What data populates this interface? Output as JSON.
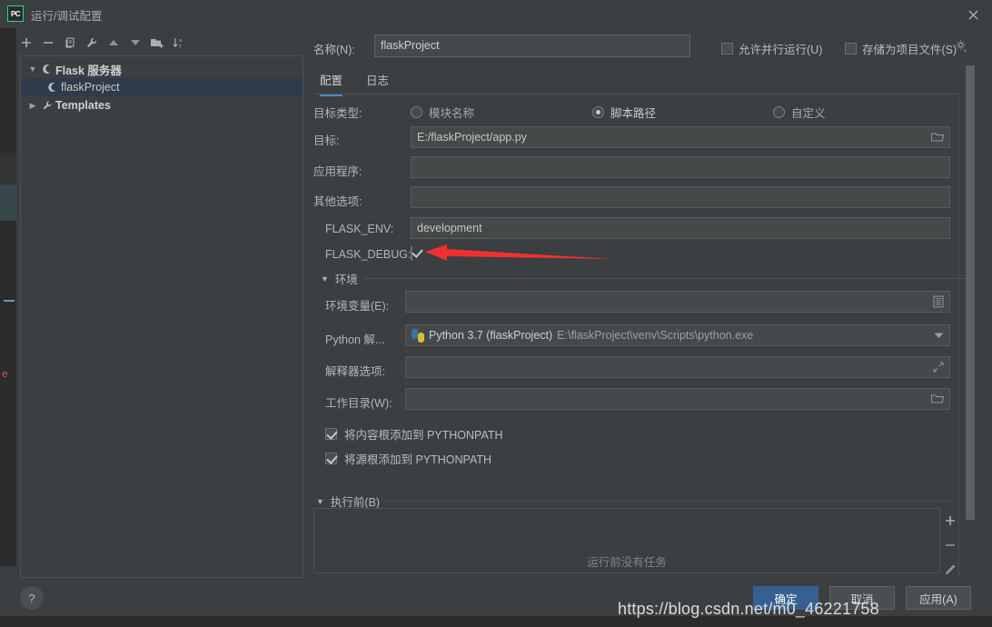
{
  "window": {
    "title": "运行/调试配置",
    "logo_text": "PC",
    "close_label": "✕"
  },
  "tree_toolbar": {
    "buttons": [
      {
        "name": "add-configuration-button",
        "icon": "plus-icon"
      },
      {
        "name": "remove-configuration-button",
        "icon": "minus-icon"
      },
      {
        "name": "copy-configuration-button",
        "icon": "copy-icon"
      },
      {
        "name": "edit-templates-button",
        "icon": "wrench-icon"
      },
      {
        "name": "move-up-button",
        "icon": "arrow-up-icon"
      },
      {
        "name": "move-down-button",
        "icon": "arrow-down-icon"
      },
      {
        "name": "new-folder-button",
        "icon": "folder-add-icon"
      },
      {
        "name": "sort-button",
        "icon": "sort-az-icon"
      }
    ]
  },
  "tree": {
    "nodes": [
      {
        "label": "Flask 服务器",
        "expanded": true,
        "selected": false,
        "icon": "flask-icon",
        "level": 0
      },
      {
        "label": "flaskProject",
        "expanded": null,
        "selected": true,
        "icon": "flask-icon",
        "level": 1
      },
      {
        "label": "Templates",
        "expanded": false,
        "selected": false,
        "icon": "wrench-icon",
        "level": 0
      }
    ]
  },
  "help_button": {
    "label": "?"
  },
  "header": {
    "name_label": "名称(N):",
    "name_value": "flaskProject",
    "allow_parallel_label": "允许并行运行(U)",
    "allow_parallel_checked": false,
    "store_as_project_label": "存储为项目文件(S)",
    "store_as_project_checked": false,
    "gear_icon": "gear-icon"
  },
  "tabs": [
    {
      "label": "配置",
      "active": true
    },
    {
      "label": "日志",
      "active": false
    }
  ],
  "form": {
    "target_type_label": "目标类型:",
    "target_type_options": [
      {
        "label": "模块名称",
        "selected": false
      },
      {
        "label": "脚本路径",
        "selected": true
      },
      {
        "label": "自定义",
        "selected": false
      }
    ],
    "target_label": "目标:",
    "target_value": "E:/flaskProject/app.py",
    "target_browse_icon": "folder-browse-icon",
    "application_label": "应用程序:",
    "application_value": "",
    "other_options_label": "其他选项:",
    "other_options_value": "",
    "flask_env_label": "FLASK_ENV:",
    "flask_env_value": "development",
    "flask_debug_label": "FLASK_DEBUG:",
    "flask_debug_checked": true
  },
  "environment_section": {
    "title": "环境",
    "expanded": true,
    "env_vars_label": "环境变量(E):",
    "env_vars_value": "",
    "env_vars_icon": "list-edit-icon",
    "interpreter_label": "Python 解...",
    "interpreter_name": "Python 3.7 (flaskProject)",
    "interpreter_path": "E:\\flaskProject\\venv\\Scripts\\python.exe",
    "interpreter_icon": "python-icon",
    "interpreter_dropdown_icon": "chevron-down-icon",
    "interpreter_options_label": "解释器选项:",
    "interpreter_options_value": "",
    "interpreter_options_icon": "expand-icon",
    "working_dir_label": "工作目录(W):",
    "working_dir_value": "",
    "working_dir_icon": "folder-browse-icon",
    "checkboxes": [
      {
        "label": "将内容根添加到 PYTHONPATH",
        "checked": true
      },
      {
        "label": "将源根添加到 PYTHONPATH",
        "checked": true
      }
    ]
  },
  "before_launch": {
    "title": "执行前(B)",
    "expanded": true,
    "empty_text": "运行前没有任务",
    "side_buttons": [
      {
        "name": "add-task-button",
        "icon": "plus-icon",
        "label": "+"
      },
      {
        "name": "remove-task-button",
        "icon": "minus-icon",
        "label": "−"
      },
      {
        "name": "edit-task-button",
        "icon": "pencil-icon",
        "label": "✎"
      }
    ]
  },
  "actions": {
    "ok_label": "确定",
    "cancel_label": "取消",
    "apply_label": "应用(A)"
  },
  "watermark": {
    "text": "https://blog.csdn.net/m0_46221758"
  },
  "annotation": {
    "arrow_color": "#f03030",
    "points_to": "FLASK_DEBUG checkbox"
  },
  "colors": {
    "background": "#3c3f41",
    "field_background": "#45494a",
    "selection": "#2f3a4a",
    "accent_blue": "#4a88c7",
    "primary_button": "#36608f",
    "annotation_red": "#f03030"
  }
}
